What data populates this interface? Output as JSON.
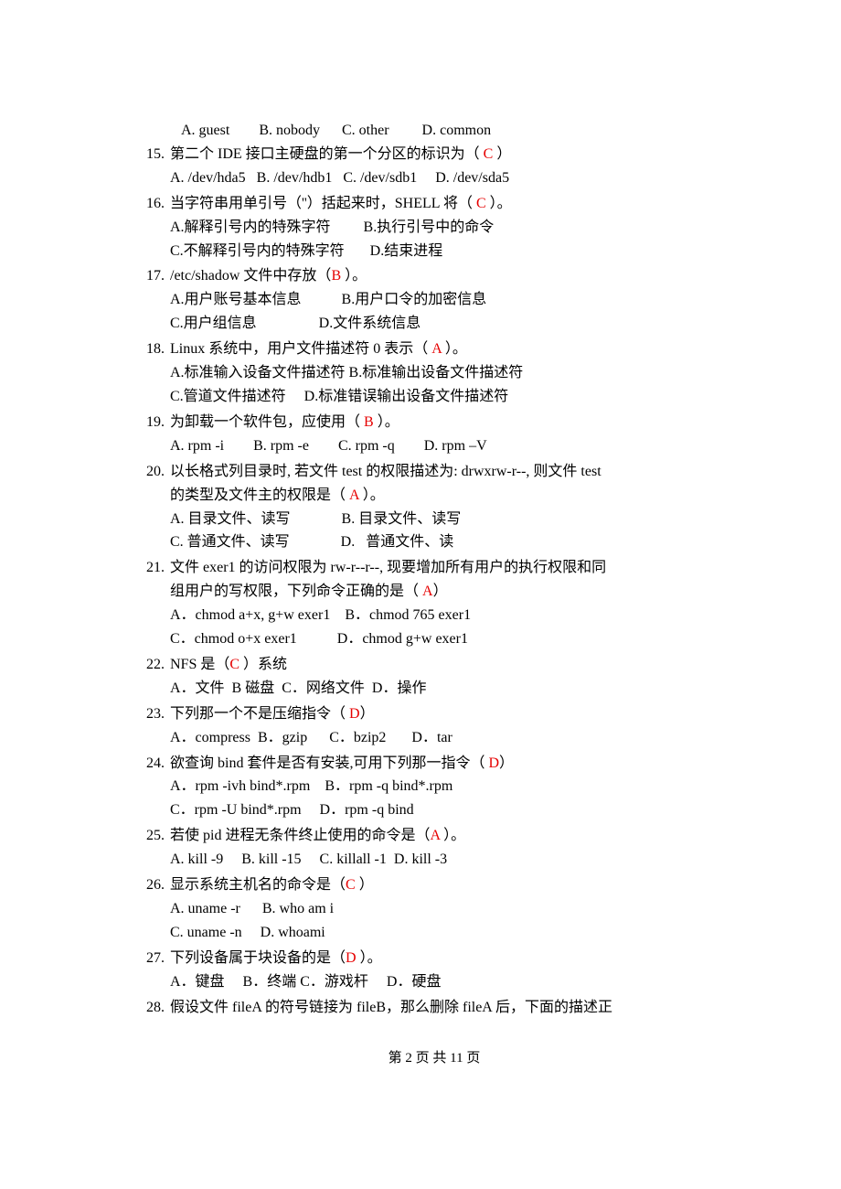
{
  "q14_opts": "A. guest        B. nobody      C. other         D. common",
  "q15": {
    "num": "15.",
    "stem_a": "第二个 IDE 接口主硬盘的第一个分区的标识为（ ",
    "ans": "C",
    "stem_b": "   ）",
    "opts": "A. /dev/hda5   B. /dev/hdb1   C. /dev/sdb1     D. /dev/sda5"
  },
  "q16": {
    "num": "16.",
    "stem_a": "当字符串用单引号（''）括起来时，SHELL 将（  ",
    "ans": "C",
    "stem_b": "  ）。",
    "opts1": "A.解释引号内的特殊字符         B.执行引号中的命令",
    "opts2": "C.不解释引号内的特殊字符       D.结束进程"
  },
  "q17": {
    "num": "17.",
    "stem_a": "/etc/shadow 文件中存放（",
    "ans": "B",
    "stem_b": "  ）。",
    "opts1": "A.用户账号基本信息           B.用户口令的加密信息",
    "opts2": "C.用户组信息                 D.文件系统信息"
  },
  "q18": {
    "num": "18.",
    "stem_a": "Linux 系统中，用户文件描述符 0 表示（  ",
    "ans": "A",
    "stem_b": "  ）。",
    "opts1": "A.标准输入设备文件描述符 B.标准输出设备文件描述符",
    "opts2": "C.管道文件描述符     D.标准错误输出设备文件描述符"
  },
  "q19": {
    "num": "19.",
    "stem_a": "为卸载一个软件包，应使用（  ",
    "ans": "B",
    "stem_b": "  ）。",
    "opts": "A. rpm -i        B. rpm -e        C. rpm -q        D. rpm –V"
  },
  "q20": {
    "num": "20.",
    "stem1": "以长格式列目录时, 若文件 test 的权限描述为: drwxrw-r--, 则文件 test",
    "stem2a": "的类型及文件主的权限是（  ",
    "ans": "A",
    "stem2b": "  ）。",
    "opts1": "A. 目录文件、读写              B. 目录文件、读写",
    "opts2": "C. 普通文件、读写              D.   普通文件、读"
  },
  "q21": {
    "num": "21.",
    "stem1": "文件 exer1 的访问权限为 rw-r--r--, 现要增加所有用户的执行权限和同",
    "stem2a": "组用户的写权限，下列命令正确的是（  ",
    "ans": "A",
    "stem2b": "）",
    "opts1": "A．chmod a+x, g+w exer1    B．chmod 765 exer1",
    "opts2": "C．chmod o+x exer1           D．chmod g+w exer1"
  },
  "q22": {
    "num": "22.",
    "stem_a": "NFS 是（",
    "ans": "C",
    "stem_b": "  ）系统",
    "opts": "A．文件  B 磁盘  C．网络文件  D．操作"
  },
  "q23": {
    "num": "23.",
    "stem_a": "下列那一个不是压缩指令（  ",
    "ans": "D",
    "stem_b": "）",
    "opts": "A．compress  B．gzip      C．bzip2       D．tar"
  },
  "q24": {
    "num": "24.",
    "stem_a": "欲查询 bind 套件是否有安装,可用下列那一指令（  ",
    "ans": "D",
    "stem_b": "）",
    "opts1": "A．rpm -ivh bind*.rpm    B．rpm -q bind*.rpm",
    "opts2": "C．rpm -U bind*.rpm     D．rpm -q bind"
  },
  "q25": {
    "num": "25.",
    "stem_a": "若使 pid 进程无条件终止使用的命令是（",
    "ans": "A",
    "stem_b": "  ）。",
    "opts": "A. kill -9     B. kill -15     C. killall -1  D. kill -3"
  },
  "q26": {
    "num": "26.",
    "stem_a": "显示系统主机名的命令是（",
    "ans": "C",
    "stem_b": "  ）",
    "opts1": "A. uname -r      B. who am i",
    "opts2": "C. uname -n     D. whoami"
  },
  "q27": {
    "num": "27.",
    "stem_a": "下列设备属于块设备的是（",
    "ans": "D",
    "stem_b": "  ）。",
    "opts": "A．键盘     B．终端 C．游戏杆     D．硬盘"
  },
  "q28": {
    "num": "28.",
    "stem": "假设文件 fileA 的符号链接为 fileB，那么删除 fileA 后，下面的描述正"
  },
  "footer": "第 2 页 共 11 页"
}
